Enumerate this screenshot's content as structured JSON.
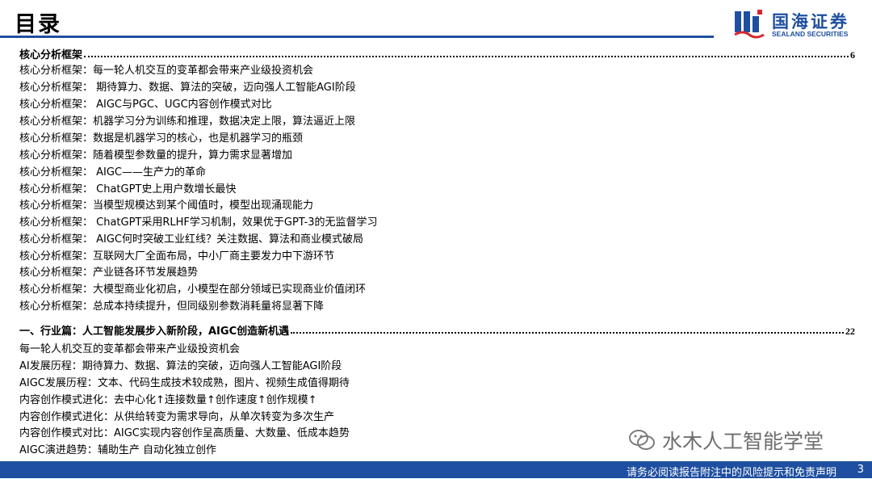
{
  "header": {
    "title": "目录",
    "logo_cn": "国海证券",
    "logo_en": "SEALAND SECURITIES",
    "accent_color": "#1f4fa0"
  },
  "toc": {
    "sections": [
      {
        "heading": "核心分析框架",
        "page": "6",
        "items": [
          "核心分析框架：每一轮人机交互的变革都会带来产业级投资机会",
          "核心分析框架： 期待算力、数据、算法的突破，迈向强人工智能AGI阶段",
          "核心分析框架： AIGC与PGC、UGC内容创作模式对比",
          "核心分析框架：机器学习分为训练和推理，数据决定上限，算法逼近上限",
          "核心分析框架：数据是机器学习的核心，也是机器学习的瓶颈",
          "核心分析框架：随着模型参数量的提升，算力需求显著增加",
          "核心分析框架： AIGC——生产力的革命",
          "核心分析框架： ChatGPT史上用户数增长最快",
          "核心分析框架：当模型规模达到某个阈值时，模型出现涌现能力",
          "核心分析框架： ChatGPT采用RLHF学习机制，效果优于GPT-3的无监督学习",
          "核心分析框架： AIGC何时突破工业红线？关注数据、算法和商业模式破局",
          "核心分析框架：互联网大厂全面布局，中小厂商主要发力中下游环节",
          "核心分析框架：产业链各环节发展趋势",
          "核心分析框架：大模型商业化初启，小模型在部分领域已实现商业价值闭环",
          "核心分析框架：总成本持续提升，但同级别参数消耗量将显著下降"
        ]
      },
      {
        "heading": "一、行业篇：人工智能发展步入新阶段，AIGC创造新机遇",
        "page": "22",
        "items": [
          "每一轮人机交互的变革都会带来产业级投资机会",
          "AI发展历程：期待算力、数据、算法的突破，迈向强人工智能AGI阶段",
          "AIGC发展历程：文本、代码生成技术较成熟，图片、视频生成值得期待",
          "内容创作模式进化：去中心化↑连接数量↑创作速度↑创作规模↑",
          "内容创作模式进化：从供给转变为需求导向，从单次转变为多次生产",
          "内容创作模式对比：AIGC实现内容创作呈高质量、大数量、低成本趋势",
          "AIGC演进趋势：辅助生产   自动化独立创作"
        ]
      }
    ]
  },
  "watermark": "水木人工智能学堂",
  "footer": {
    "disclaimer": "请务必阅读报告附注中的风险提示和免责声明",
    "page_number": "3"
  }
}
